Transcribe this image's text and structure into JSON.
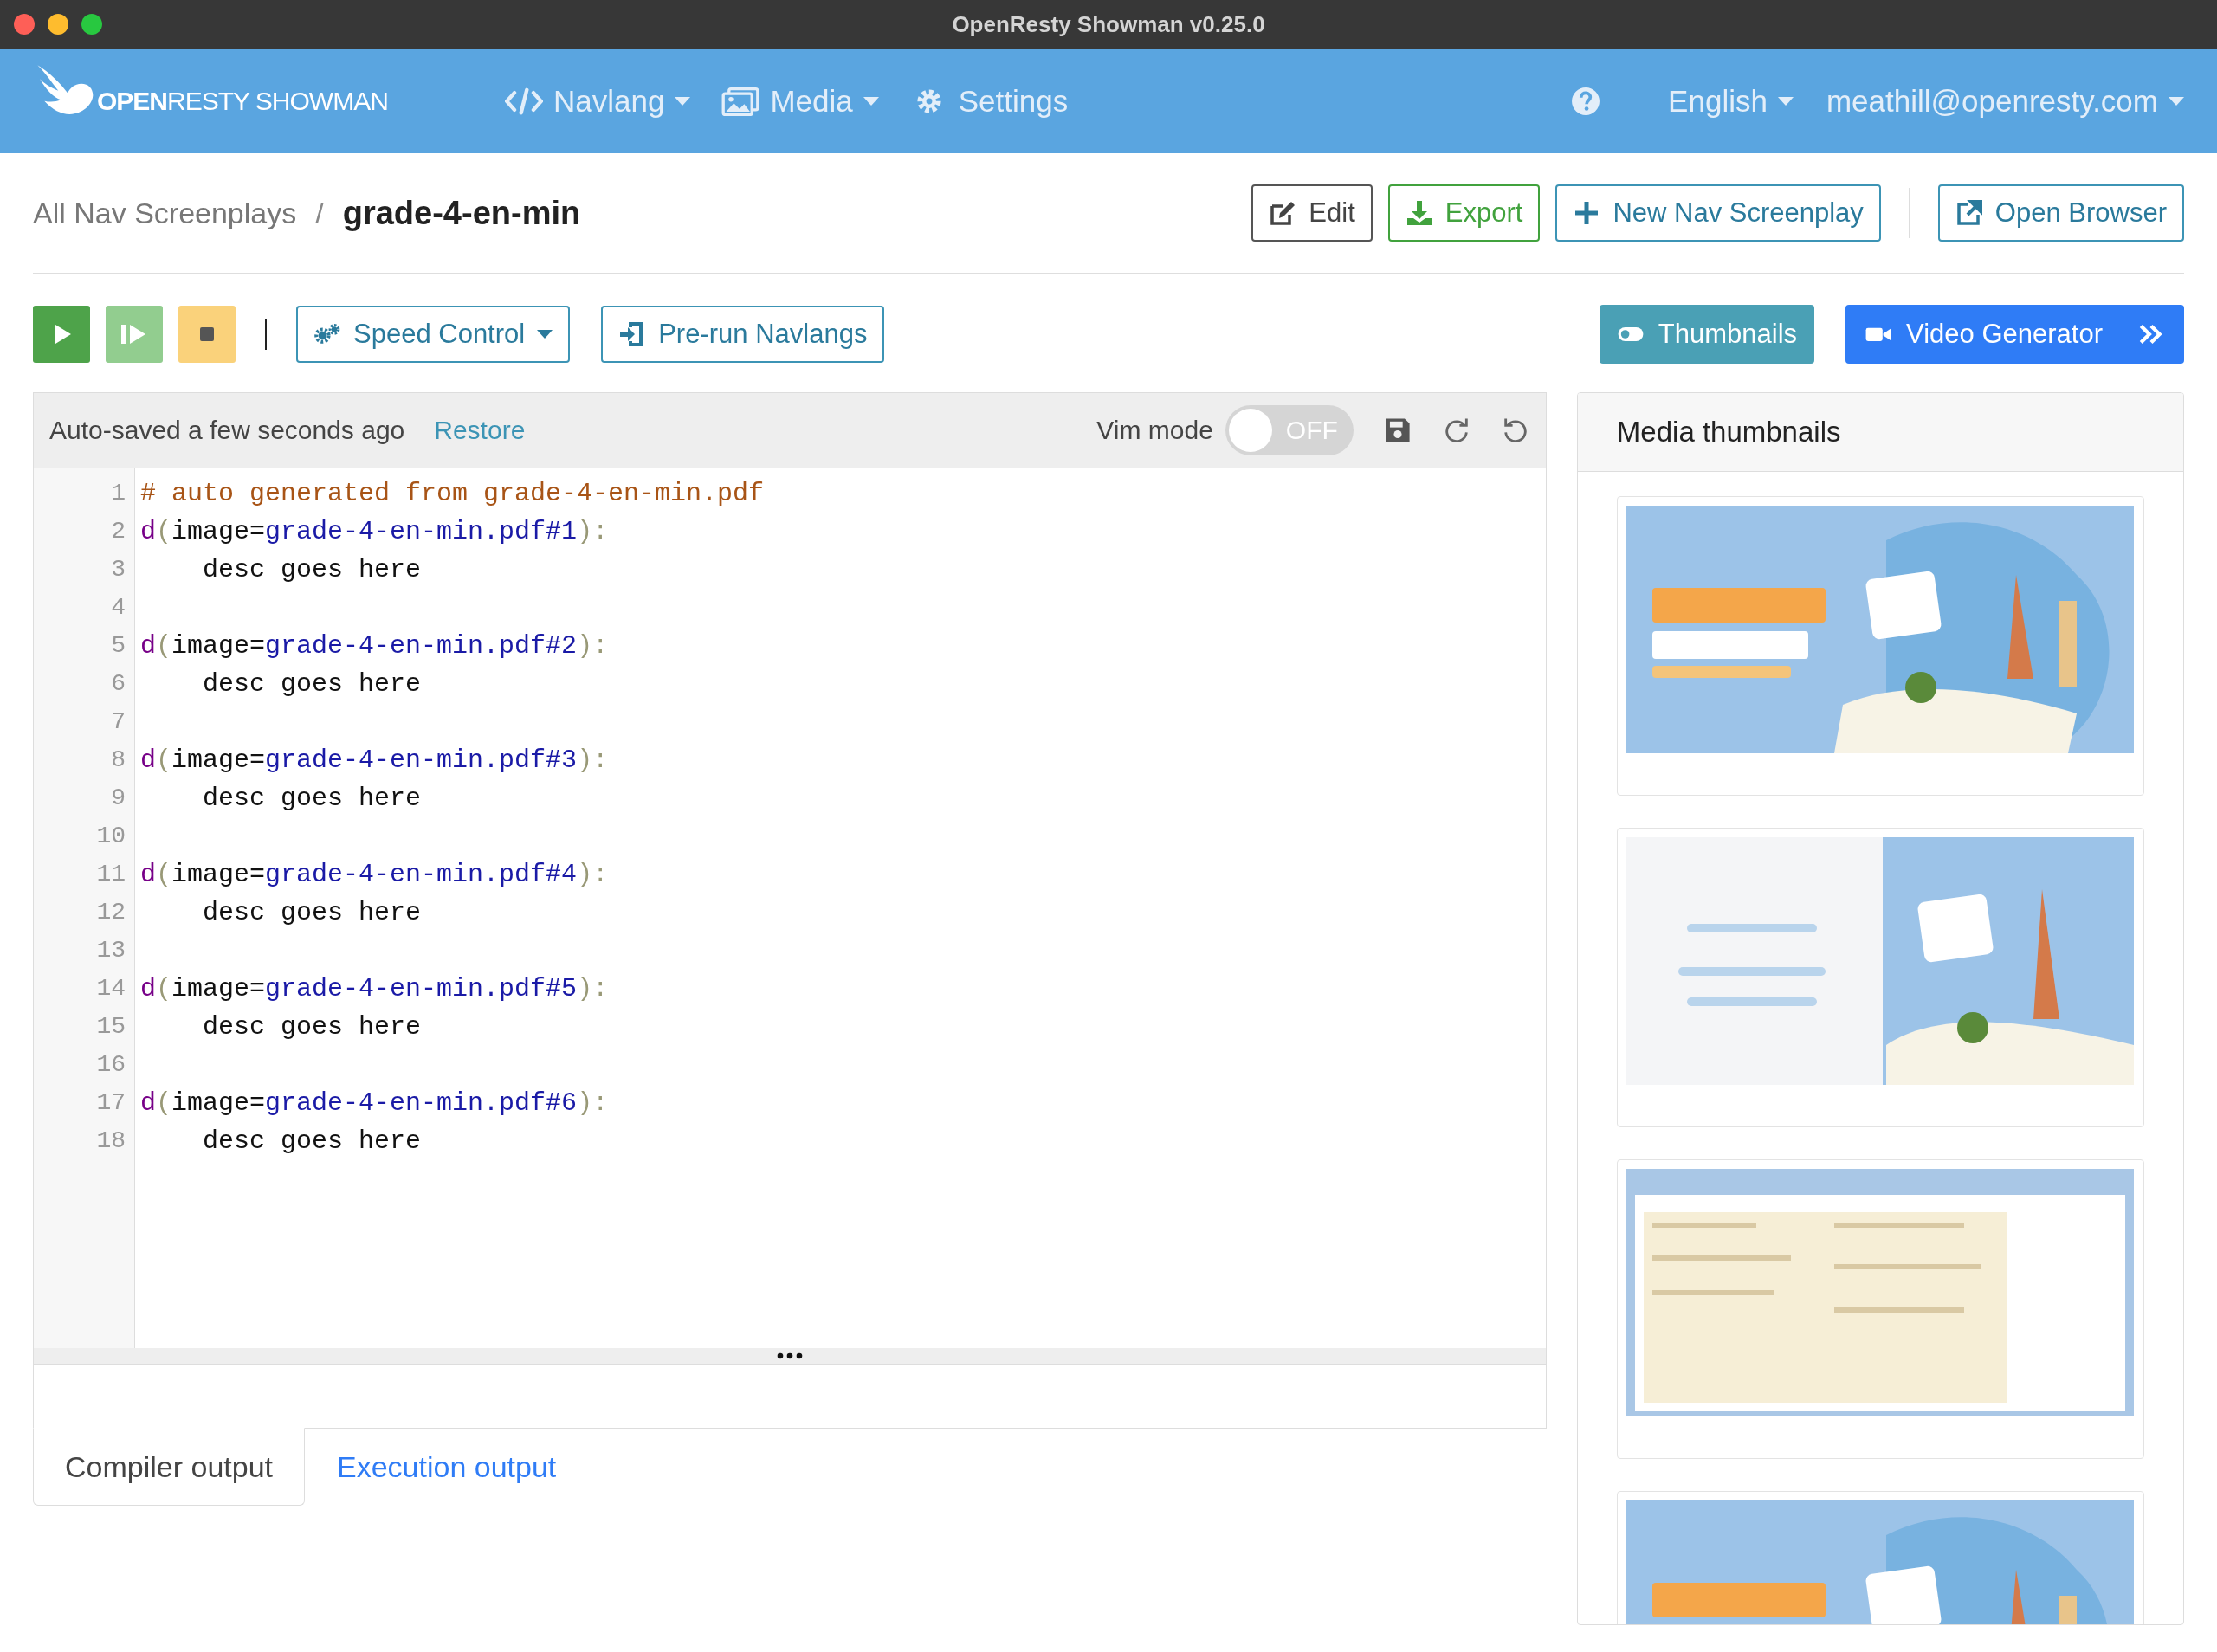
{
  "window": {
    "title": "OpenResty Showman v0.25.0"
  },
  "navbar": {
    "logo": "**OPEN**RESTY SHOWMAN",
    "items": [
      {
        "label": "Navlang",
        "dropdown": true
      },
      {
        "label": "Media",
        "dropdown": true
      },
      {
        "label": "Settings",
        "dropdown": false
      }
    ],
    "language": "English",
    "user": "meathill@openresty.com"
  },
  "breadcrumb": {
    "parent": "All Nav Screenplays",
    "separator": "/",
    "current": "grade-4-en-min"
  },
  "header_buttons": [
    {
      "label": "Edit",
      "kind": "secondary"
    },
    {
      "label": "Export",
      "kind": "success"
    },
    {
      "label": "New Nav Screenplay",
      "kind": "info"
    }
  ],
  "open_browser": "Open Browser",
  "toolbar": {
    "speed_control": "Speed Control",
    "prerun": "Pre-run Navlangs",
    "thumbnails": "Thumbnails",
    "video_generator": "Video Generator"
  },
  "editor": {
    "autosave": "Auto-saved a few seconds ago",
    "restore": "Restore",
    "vim_mode": {
      "label": "Vim mode",
      "on": false,
      "state_text": "OFF"
    },
    "lines": [
      {
        "number": "1",
        "tokens": [
          {
            "text": "# auto generated from grade-4-en-min.pdf",
            "kind": "comment"
          }
        ]
      },
      {
        "number": "2",
        "tokens": [
          {
            "text": "d",
            "kind": "keyword"
          },
          {
            "text": "(",
            "kind": "punct"
          },
          {
            "text": "image=",
            "kind": "plain"
          },
          {
            "text": "grade-4-en-min.pdf#1",
            "kind": "value"
          },
          {
            "text": "):",
            "kind": "punct"
          }
        ]
      },
      {
        "number": "3",
        "tokens": [
          {
            "text": "    desc goes here",
            "kind": "plain"
          }
        ]
      },
      {
        "number": "4"
      },
      {
        "number": "5",
        "tokens": [
          {
            "text": "d",
            "kind": "keyword"
          },
          {
            "text": "(",
            "kind": "punct"
          },
          {
            "text": "image=",
            "kind": "plain"
          },
          {
            "text": "grade-4-en-min.pdf#2",
            "kind": "value"
          },
          {
            "text": "):",
            "kind": "punct"
          }
        ]
      },
      {
        "number": "6",
        "tokens": [
          {
            "text": "    desc goes here",
            "kind": "plain"
          }
        ]
      },
      {
        "number": "7"
      },
      {
        "number": "8",
        "tokens": [
          {
            "text": "d",
            "kind": "keyword"
          },
          {
            "text": "(",
            "kind": "punct"
          },
          {
            "text": "image=",
            "kind": "plain"
          },
          {
            "text": "grade-4-en-min.pdf#3",
            "kind": "value"
          },
          {
            "text": "):",
            "kind": "punct"
          }
        ]
      },
      {
        "number": "9",
        "tokens": [
          {
            "text": "    desc goes here",
            "kind": "plain"
          }
        ]
      },
      {
        "number": "10"
      },
      {
        "number": "11",
        "tokens": [
          {
            "text": "d",
            "kind": "keyword"
          },
          {
            "text": "(",
            "kind": "punct"
          },
          {
            "text": "image=",
            "kind": "plain"
          },
          {
            "text": "grade-4-en-min.pdf#4",
            "kind": "value"
          },
          {
            "text": "):",
            "kind": "punct"
          }
        ]
      },
      {
        "number": "12",
        "tokens": [
          {
            "text": "    desc goes here",
            "kind": "plain"
          }
        ]
      },
      {
        "number": "13"
      },
      {
        "number": "14",
        "tokens": [
          {
            "text": "d",
            "kind": "keyword"
          },
          {
            "text": "(",
            "kind": "punct"
          },
          {
            "text": "image=",
            "kind": "plain"
          },
          {
            "text": "grade-4-en-min.pdf#5",
            "kind": "value"
          },
          {
            "text": "):",
            "kind": "punct"
          }
        ]
      },
      {
        "number": "15",
        "tokens": [
          {
            "text": "    desc goes here",
            "kind": "plain"
          }
        ]
      },
      {
        "number": "16"
      },
      {
        "number": "17",
        "tokens": [
          {
            "text": "d",
            "kind": "keyword"
          },
          {
            "text": "(",
            "kind": "punct"
          },
          {
            "text": "image=",
            "kind": "plain"
          },
          {
            "text": "grade-4-en-min.pdf#6",
            "kind": "value"
          },
          {
            "text": "):",
            "kind": "punct"
          }
        ]
      },
      {
        "number": "18",
        "tokens": [
          {
            "text": "    desc goes here",
            "kind": "plain"
          }
        ]
      }
    ]
  },
  "output_tabs": [
    {
      "label": "Compiler output",
      "selected": true
    },
    {
      "label": "Execution output",
      "selected": false
    }
  ],
  "media_panel": {
    "title": "Media thumbnails"
  }
}
